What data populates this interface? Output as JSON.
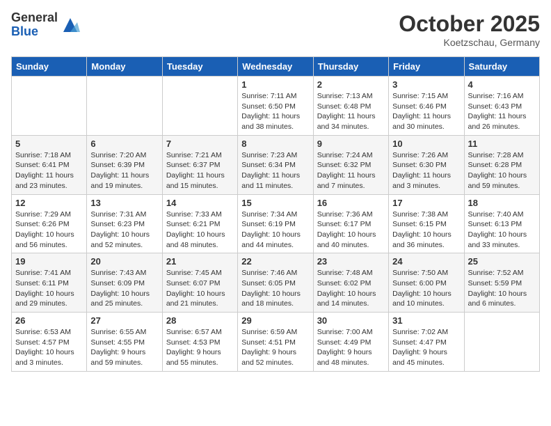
{
  "logo": {
    "general": "General",
    "blue": "Blue"
  },
  "header": {
    "month": "October 2025",
    "location": "Koetzschau, Germany"
  },
  "weekdays": [
    "Sunday",
    "Monday",
    "Tuesday",
    "Wednesday",
    "Thursday",
    "Friday",
    "Saturday"
  ],
  "weeks": [
    [
      {
        "day": "",
        "info": ""
      },
      {
        "day": "",
        "info": ""
      },
      {
        "day": "",
        "info": ""
      },
      {
        "day": "1",
        "info": "Sunrise: 7:11 AM\nSunset: 6:50 PM\nDaylight: 11 hours\nand 38 minutes."
      },
      {
        "day": "2",
        "info": "Sunrise: 7:13 AM\nSunset: 6:48 PM\nDaylight: 11 hours\nand 34 minutes."
      },
      {
        "day": "3",
        "info": "Sunrise: 7:15 AM\nSunset: 6:46 PM\nDaylight: 11 hours\nand 30 minutes."
      },
      {
        "day": "4",
        "info": "Sunrise: 7:16 AM\nSunset: 6:43 PM\nDaylight: 11 hours\nand 26 minutes."
      }
    ],
    [
      {
        "day": "5",
        "info": "Sunrise: 7:18 AM\nSunset: 6:41 PM\nDaylight: 11 hours\nand 23 minutes."
      },
      {
        "day": "6",
        "info": "Sunrise: 7:20 AM\nSunset: 6:39 PM\nDaylight: 11 hours\nand 19 minutes."
      },
      {
        "day": "7",
        "info": "Sunrise: 7:21 AM\nSunset: 6:37 PM\nDaylight: 11 hours\nand 15 minutes."
      },
      {
        "day": "8",
        "info": "Sunrise: 7:23 AM\nSunset: 6:34 PM\nDaylight: 11 hours\nand 11 minutes."
      },
      {
        "day": "9",
        "info": "Sunrise: 7:24 AM\nSunset: 6:32 PM\nDaylight: 11 hours\nand 7 minutes."
      },
      {
        "day": "10",
        "info": "Sunrise: 7:26 AM\nSunset: 6:30 PM\nDaylight: 11 hours\nand 3 minutes."
      },
      {
        "day": "11",
        "info": "Sunrise: 7:28 AM\nSunset: 6:28 PM\nDaylight: 10 hours\nand 59 minutes."
      }
    ],
    [
      {
        "day": "12",
        "info": "Sunrise: 7:29 AM\nSunset: 6:26 PM\nDaylight: 10 hours\nand 56 minutes."
      },
      {
        "day": "13",
        "info": "Sunrise: 7:31 AM\nSunset: 6:23 PM\nDaylight: 10 hours\nand 52 minutes."
      },
      {
        "day": "14",
        "info": "Sunrise: 7:33 AM\nSunset: 6:21 PM\nDaylight: 10 hours\nand 48 minutes."
      },
      {
        "day": "15",
        "info": "Sunrise: 7:34 AM\nSunset: 6:19 PM\nDaylight: 10 hours\nand 44 minutes."
      },
      {
        "day": "16",
        "info": "Sunrise: 7:36 AM\nSunset: 6:17 PM\nDaylight: 10 hours\nand 40 minutes."
      },
      {
        "day": "17",
        "info": "Sunrise: 7:38 AM\nSunset: 6:15 PM\nDaylight: 10 hours\nand 36 minutes."
      },
      {
        "day": "18",
        "info": "Sunrise: 7:40 AM\nSunset: 6:13 PM\nDaylight: 10 hours\nand 33 minutes."
      }
    ],
    [
      {
        "day": "19",
        "info": "Sunrise: 7:41 AM\nSunset: 6:11 PM\nDaylight: 10 hours\nand 29 minutes."
      },
      {
        "day": "20",
        "info": "Sunrise: 7:43 AM\nSunset: 6:09 PM\nDaylight: 10 hours\nand 25 minutes."
      },
      {
        "day": "21",
        "info": "Sunrise: 7:45 AM\nSunset: 6:07 PM\nDaylight: 10 hours\nand 21 minutes."
      },
      {
        "day": "22",
        "info": "Sunrise: 7:46 AM\nSunset: 6:05 PM\nDaylight: 10 hours\nand 18 minutes."
      },
      {
        "day": "23",
        "info": "Sunrise: 7:48 AM\nSunset: 6:02 PM\nDaylight: 10 hours\nand 14 minutes."
      },
      {
        "day": "24",
        "info": "Sunrise: 7:50 AM\nSunset: 6:00 PM\nDaylight: 10 hours\nand 10 minutes."
      },
      {
        "day": "25",
        "info": "Sunrise: 7:52 AM\nSunset: 5:59 PM\nDaylight: 10 hours\nand 6 minutes."
      }
    ],
    [
      {
        "day": "26",
        "info": "Sunrise: 6:53 AM\nSunset: 4:57 PM\nDaylight: 10 hours\nand 3 minutes."
      },
      {
        "day": "27",
        "info": "Sunrise: 6:55 AM\nSunset: 4:55 PM\nDaylight: 9 hours\nand 59 minutes."
      },
      {
        "day": "28",
        "info": "Sunrise: 6:57 AM\nSunset: 4:53 PM\nDaylight: 9 hours\nand 55 minutes."
      },
      {
        "day": "29",
        "info": "Sunrise: 6:59 AM\nSunset: 4:51 PM\nDaylight: 9 hours\nand 52 minutes."
      },
      {
        "day": "30",
        "info": "Sunrise: 7:00 AM\nSunset: 4:49 PM\nDaylight: 9 hours\nand 48 minutes."
      },
      {
        "day": "31",
        "info": "Sunrise: 7:02 AM\nSunset: 4:47 PM\nDaylight: 9 hours\nand 45 minutes."
      },
      {
        "day": "",
        "info": ""
      }
    ]
  ]
}
